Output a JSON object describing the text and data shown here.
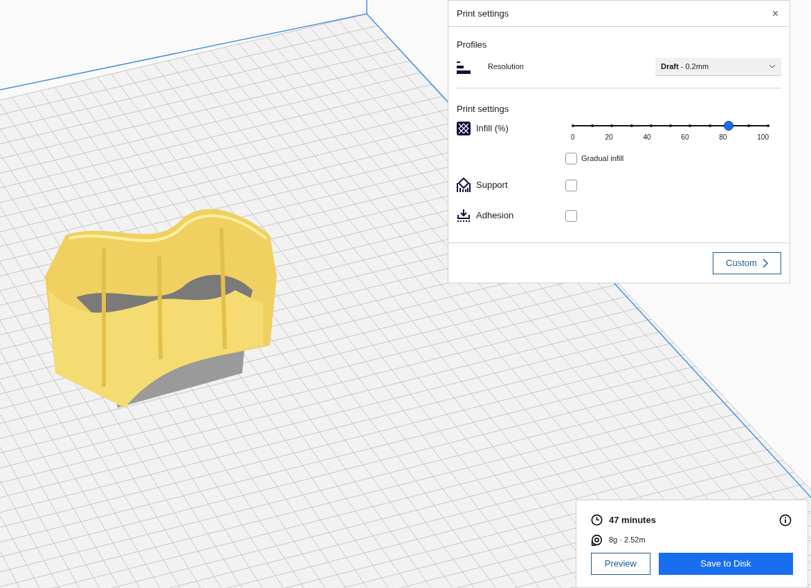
{
  "print_settings": {
    "title": "Print settings",
    "close": "×",
    "profiles_heading": "Profiles",
    "resolution_label": "Resolution",
    "resolution_value": "**Draft** - 0.2mm",
    "settings_heading": "Print settings",
    "infill": {
      "label": "Infill (%)",
      "level": 0.8,
      "ticks": [
        "0",
        "20",
        "40",
        "60",
        "80",
        "100"
      ]
    },
    "gradual_infill": {
      "label": "Gradual infill",
      "checked": false
    },
    "support": {
      "label": "Support",
      "checked": false
    },
    "adhesion": {
      "label": "Adhesion",
      "checked": false
    },
    "custom_button": "Custom"
  },
  "job": {
    "time": "47 minutes",
    "material": "8g · 2.52m",
    "preview_button": "Preview",
    "save_button": "Save to Disk"
  }
}
